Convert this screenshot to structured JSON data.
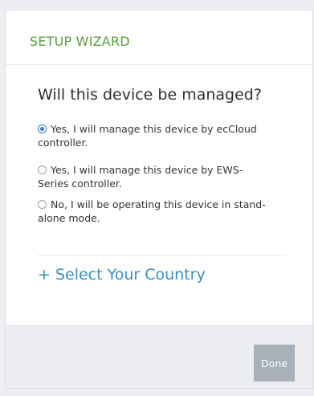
{
  "wizard": {
    "title": "SETUP WIZARD",
    "question": "Will this device be managed?",
    "options": [
      {
        "label": "Yes, I will manage this device by ecCloud controller.",
        "selected": true
      },
      {
        "label": "Yes, I will manage this device by EWS-Series controller.",
        "selected": false
      },
      {
        "label": "No, I will be operating this device in stand-alone mode.",
        "selected": false
      }
    ],
    "country_link": "+ Select Your Country",
    "done_label": "Done"
  },
  "colors": {
    "title_green": "#5a9d3c",
    "link_blue": "#3a8ec0",
    "radio_selected": "#2b7fd6",
    "button_disabled": "#a7b1b7"
  }
}
